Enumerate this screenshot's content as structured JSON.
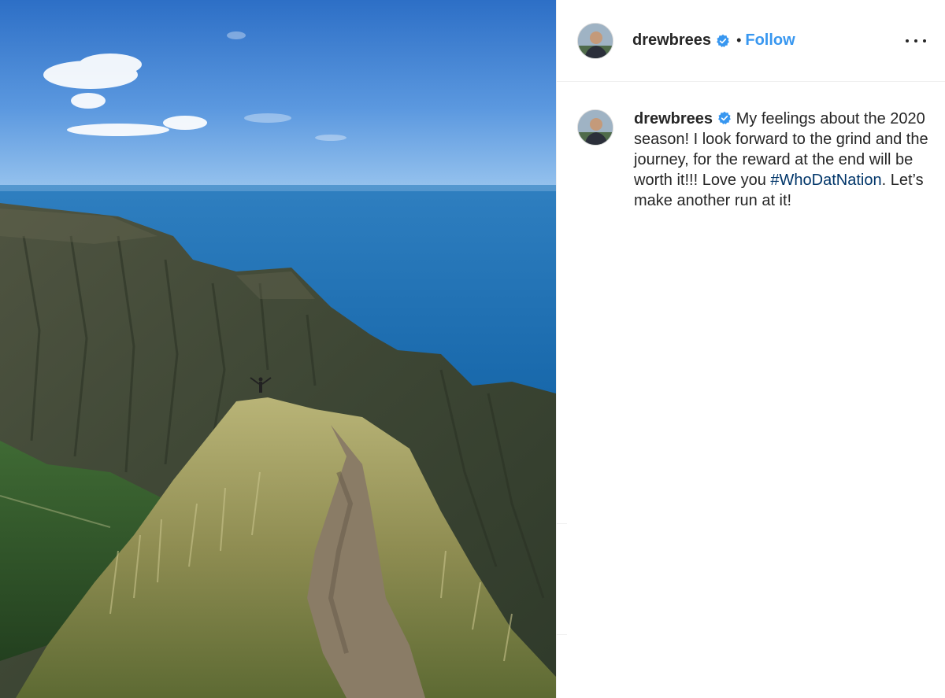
{
  "post": {
    "image_alt": "Hiker standing on a narrow grassy ridge trail above green sea cliffs and the ocean",
    "header": {
      "username": "drewbrees",
      "verified": true,
      "separator": "•",
      "follow_label": "Follow",
      "more_icon": "more-options-icon"
    },
    "caption": {
      "username": "drewbrees",
      "text_before_hashtag": " My feelings about the 2020 season! I look forward to the grind and the journey, for the reward at the end will be worth it!!! Love you ",
      "hashtag": "#WhoDatNation",
      "text_after_hashtag": ". Let’s make another run at it!"
    }
  },
  "colors": {
    "follow_blue": "#3897f0",
    "verified_blue": "#3897f0",
    "hashtag": "#003569",
    "text": "#262626",
    "divider": "#efefef"
  }
}
